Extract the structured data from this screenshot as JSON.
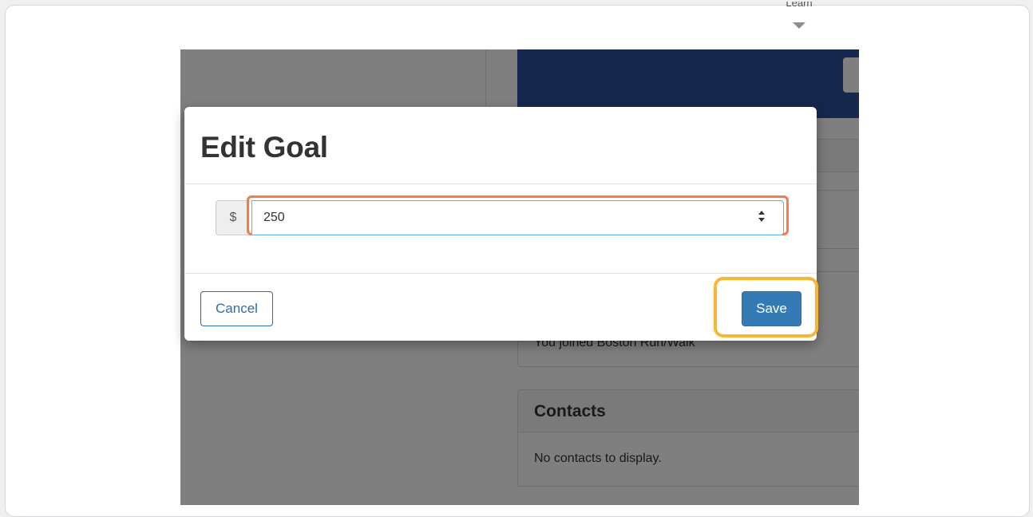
{
  "top_menu": {
    "label": "Learn"
  },
  "background_page": {
    "activity_text": "You joined Boston Run/Walk",
    "contacts_panel": {
      "heading": "Contacts",
      "empty_message": "No contacts to display."
    }
  },
  "modal": {
    "title": "Edit Goal",
    "currency_addon": "$",
    "goal_value": "250",
    "cancel_label": "Cancel",
    "save_label": "Save"
  },
  "colors": {
    "hero_bg": "#2d4f9a",
    "primary_button": "#337ab7",
    "input_highlight": "#f47c4a",
    "save_highlight": "#f9b633"
  }
}
